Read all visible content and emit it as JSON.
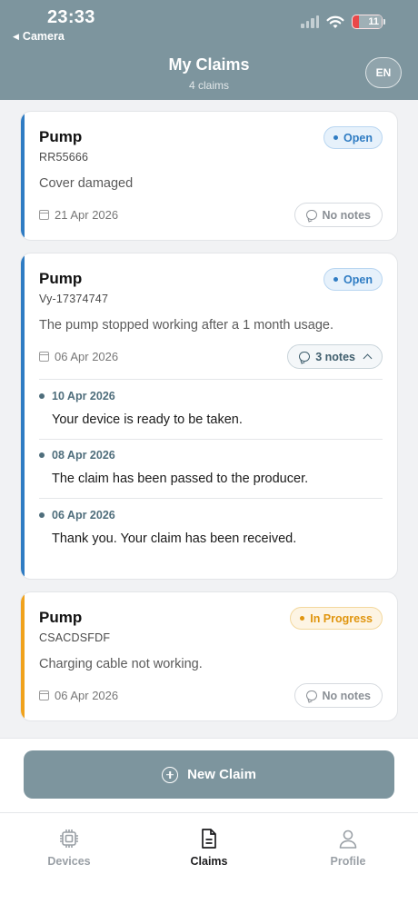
{
  "status_bar": {
    "time": "23:33",
    "back_app": "Camera",
    "battery": "11"
  },
  "header": {
    "title": "My Claims",
    "subtitle": "4 claims",
    "language": "EN"
  },
  "claims": [
    {
      "product": "Pump",
      "code": "RR55666",
      "status": "Open",
      "description": "Cover damaged",
      "date": "21 Apr 2026",
      "notes_label": "No notes",
      "accent": "#2f7cc3"
    },
    {
      "product": "Pump",
      "code": "Vy-17374747",
      "status": "Open",
      "description": "The pump stopped working after a 1 month usage.",
      "date": "06 Apr 2026",
      "notes_label": "3 notes",
      "accent": "#2f7cc3",
      "notes": [
        {
          "date": "10 Apr 2026",
          "text": "Your device is ready to be taken."
        },
        {
          "date": "08 Apr 2026",
          "text": "The claim has been passed to the producer."
        },
        {
          "date": "06 Apr 2026",
          "text": "Thank you. Your claim has been received."
        }
      ]
    },
    {
      "product": "Pump",
      "code": "CSACDSFDF",
      "status": "In Progress",
      "description": "Charging cable not working.",
      "date": "06 Apr 2026",
      "notes_label": "No notes",
      "accent": "#f0a21d"
    }
  ],
  "actions": {
    "new_claim": "New Claim"
  },
  "tabs": [
    {
      "label": "Devices",
      "icon": "chip-icon",
      "active": false
    },
    {
      "label": "Claims",
      "icon": "document-icon",
      "active": true
    },
    {
      "label": "Profile",
      "icon": "person-icon",
      "active": false
    }
  ],
  "colors": {
    "header_bg": "#7d959e",
    "open": "#2f7cc3",
    "in_progress": "#e0950e"
  }
}
